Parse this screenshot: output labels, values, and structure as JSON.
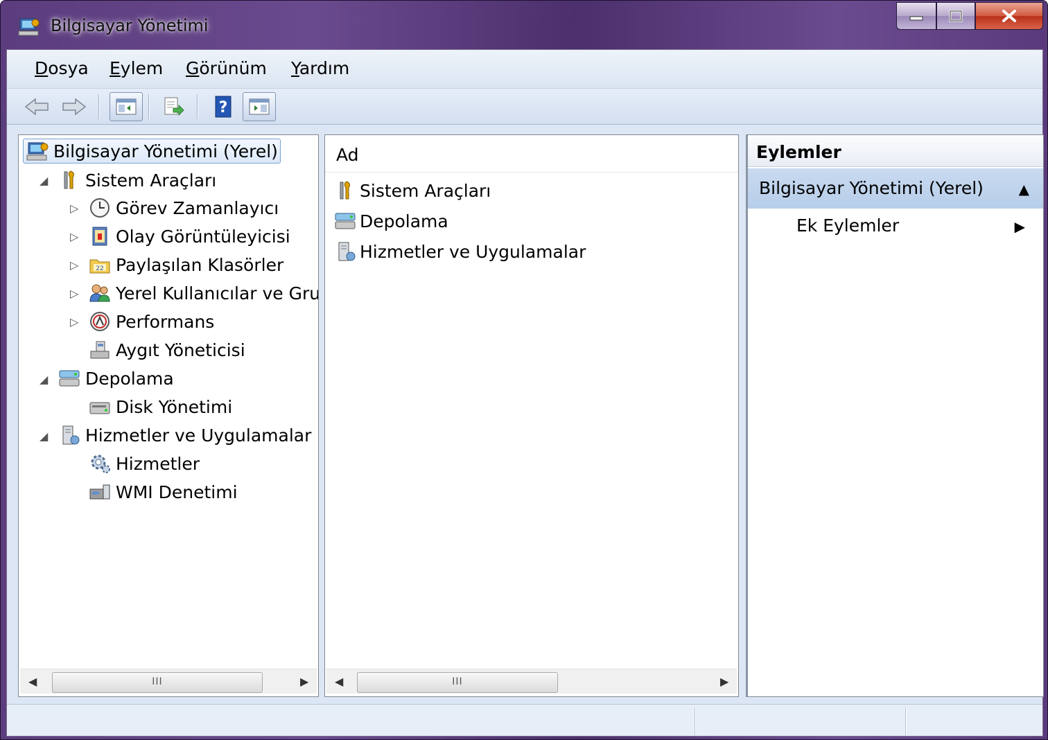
{
  "window": {
    "title": "Bilgisayar Yönetimi",
    "min_label": "",
    "max_label": "",
    "close_label": ""
  },
  "menu": [
    {
      "label": "Dosya",
      "accel": "D",
      "rest": "osya"
    },
    {
      "label": "Eylem",
      "accel": "E",
      "rest": "ylem"
    },
    {
      "label": "Görünüm",
      "accel": "G",
      "rest": "örünüm"
    },
    {
      "label": "Yardım",
      "accel": "Y",
      "rest": "ardım"
    }
  ],
  "toolbar": [
    "back-arrow-icon",
    "forward-arrow-icon",
    "show-hide-console-tree-icon",
    "export-list-icon",
    "help-icon",
    "show-hide-action-pane-icon"
  ],
  "tree": {
    "root": "Bilgisayar Yönetimi (Yerel)",
    "sistem_araclari": "Sistem Araçları",
    "gorev_zamanlayici": "Görev Zamanlayıcı",
    "olay_goruntuleyicisi": "Olay Görüntüleyicisi",
    "paylasilan_klasorler": "Paylaşılan Klasörler",
    "yerel_kullanicilar": "Yerel Kullanıcılar ve Gru",
    "performans": "Performans",
    "aygit_yoneticisi": "Aygıt Yöneticisi",
    "depolama": "Depolama",
    "disk_yonetimi": "Disk Yönetimi",
    "hizmetler_uygulamalar": "Hizmetler ve Uygulamalar",
    "hizmetler": "Hizmetler",
    "wmi": "WMI Denetimi"
  },
  "list": {
    "column_name": "Ad",
    "items": [
      "Sistem Araçları",
      "Depolama",
      "Hizmetler ve Uygulamalar"
    ]
  },
  "actions": {
    "header": "Eylemler",
    "section": "Bilgisayar Yönetimi (Yerel)",
    "item": "Ek Eylemler"
  },
  "scrollbar": {
    "thumb_grip": "III"
  },
  "colors": {
    "title_bar": "#5b3c7d",
    "close_button": "#c8452c",
    "selection": "#dbe8f9",
    "action_section": "#c1d5ee"
  }
}
